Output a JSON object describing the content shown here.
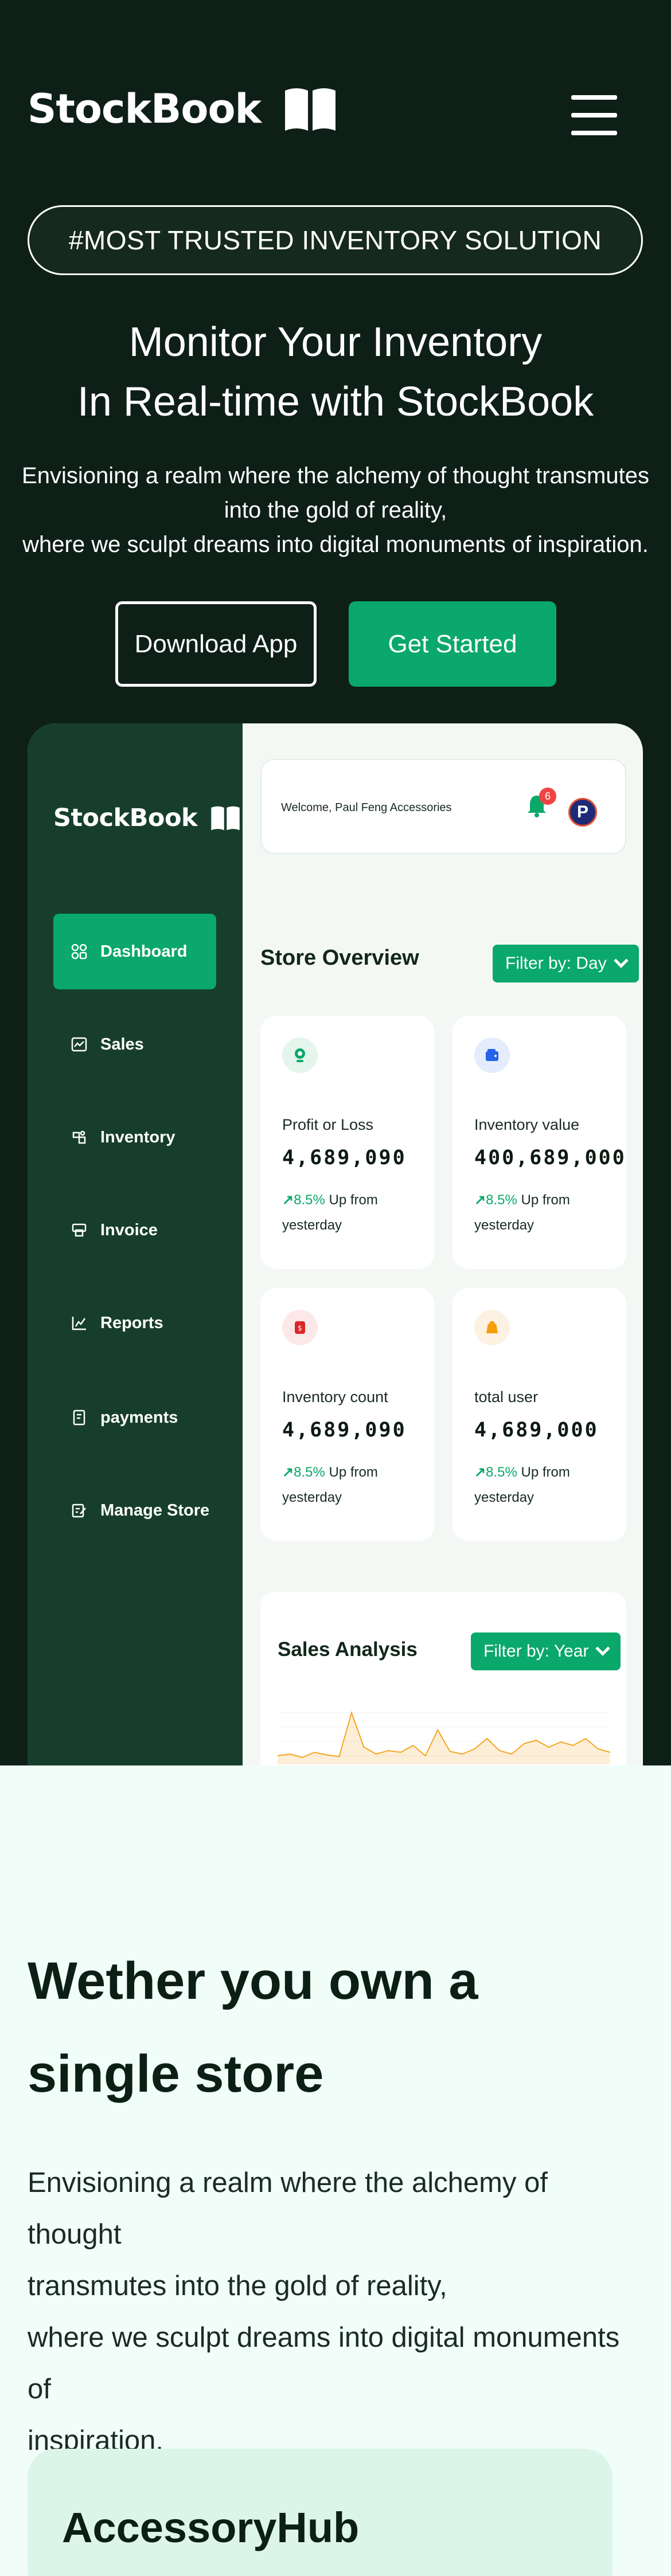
{
  "header": {
    "brand": "StockBook",
    "menu_icon": "hamburger-icon"
  },
  "hero": {
    "badge": "#MOST TRUSTED INVENTORY SOLUTION",
    "headline_line1": "Monitor Your Inventory",
    "headline_line2": "In Real-time with StockBook",
    "sub_line1": "Envisioning a realm where the alchemy of thought transmutes",
    "sub_line2": "into the gold of reality,",
    "sub_line3": "where we sculpt dreams into digital monuments of inspiration.",
    "btn_download": "Download App",
    "btn_start": "Get Started"
  },
  "dashboard": {
    "brand": "StockBook",
    "nav": [
      {
        "label": "Dashboard",
        "icon": "grid-icon"
      },
      {
        "label": "Sales",
        "icon": "chart-box-icon"
      },
      {
        "label": "Inventory",
        "icon": "box-icon"
      },
      {
        "label": "Invoice",
        "icon": "printer-icon"
      },
      {
        "label": "Reports",
        "icon": "bar-chart-icon"
      },
      {
        "label": "payments",
        "icon": "receipt-icon"
      },
      {
        "label": "Manage Store",
        "icon": "edit-icon"
      }
    ],
    "welcome": "Welcome, Paul Feng Accessories",
    "notification_count": "6",
    "avatar_letter": "P",
    "overview_title": "Store Overview",
    "overview_filter": "Filter by: Day",
    "cards": [
      {
        "label": "Profit or Loss",
        "value": "4,689,090",
        "pct": "8.5%",
        "tail": "Up from yesterday",
        "icon": "money-icon",
        "icon_bg": "#e3f5ec",
        "icon_color": "#0aa86a"
      },
      {
        "label": "Inventory value",
        "value": "400,689,000",
        "pct": "8.5%",
        "tail": "Up from yesterday",
        "icon": "wallet-icon",
        "icon_bg": "#e5ecfb",
        "icon_color": "#2563eb"
      },
      {
        "label": "Inventory count",
        "value": "4,689,090",
        "pct": "8.5%",
        "tail": "Up from yesterday",
        "icon": "tag-icon",
        "icon_bg": "#fde8e8",
        "icon_color": "#dc2626"
      },
      {
        "label": "total user",
        "value": "4,689,000",
        "pct": "8.5%",
        "tail": "Up from yesterday",
        "icon": "bag-icon",
        "icon_bg": "#fdf1e2",
        "icon_color": "#f59e0b"
      }
    ],
    "sales_title": "Sales Analysis",
    "sales_filter": "Filter by: Year",
    "accent": "#0aa86a",
    "chart_data": {
      "type": "area",
      "x": [],
      "series": [
        {
          "values": [
            10,
            12,
            8,
            14,
            11,
            9,
            60,
            20,
            12,
            16,
            14,
            22,
            10,
            40,
            15,
            12,
            18,
            30,
            16,
            12,
            24,
            28,
            20,
            26,
            22,
            30,
            18,
            14
          ]
        }
      ],
      "color": "#f5a623"
    }
  },
  "section2": {
    "title_line1": "Wether you own a",
    "title_line2": "single store",
    "text_line1": "Envisioning a realm where the alchemy of thought",
    "text_line2": "transmutes into the gold of reality,",
    "text_line3": "where we sculpt dreams into digital monuments",
    "text_line4": "of",
    "text_line5": "inspiration.",
    "card_title": "AccessoryHub"
  }
}
